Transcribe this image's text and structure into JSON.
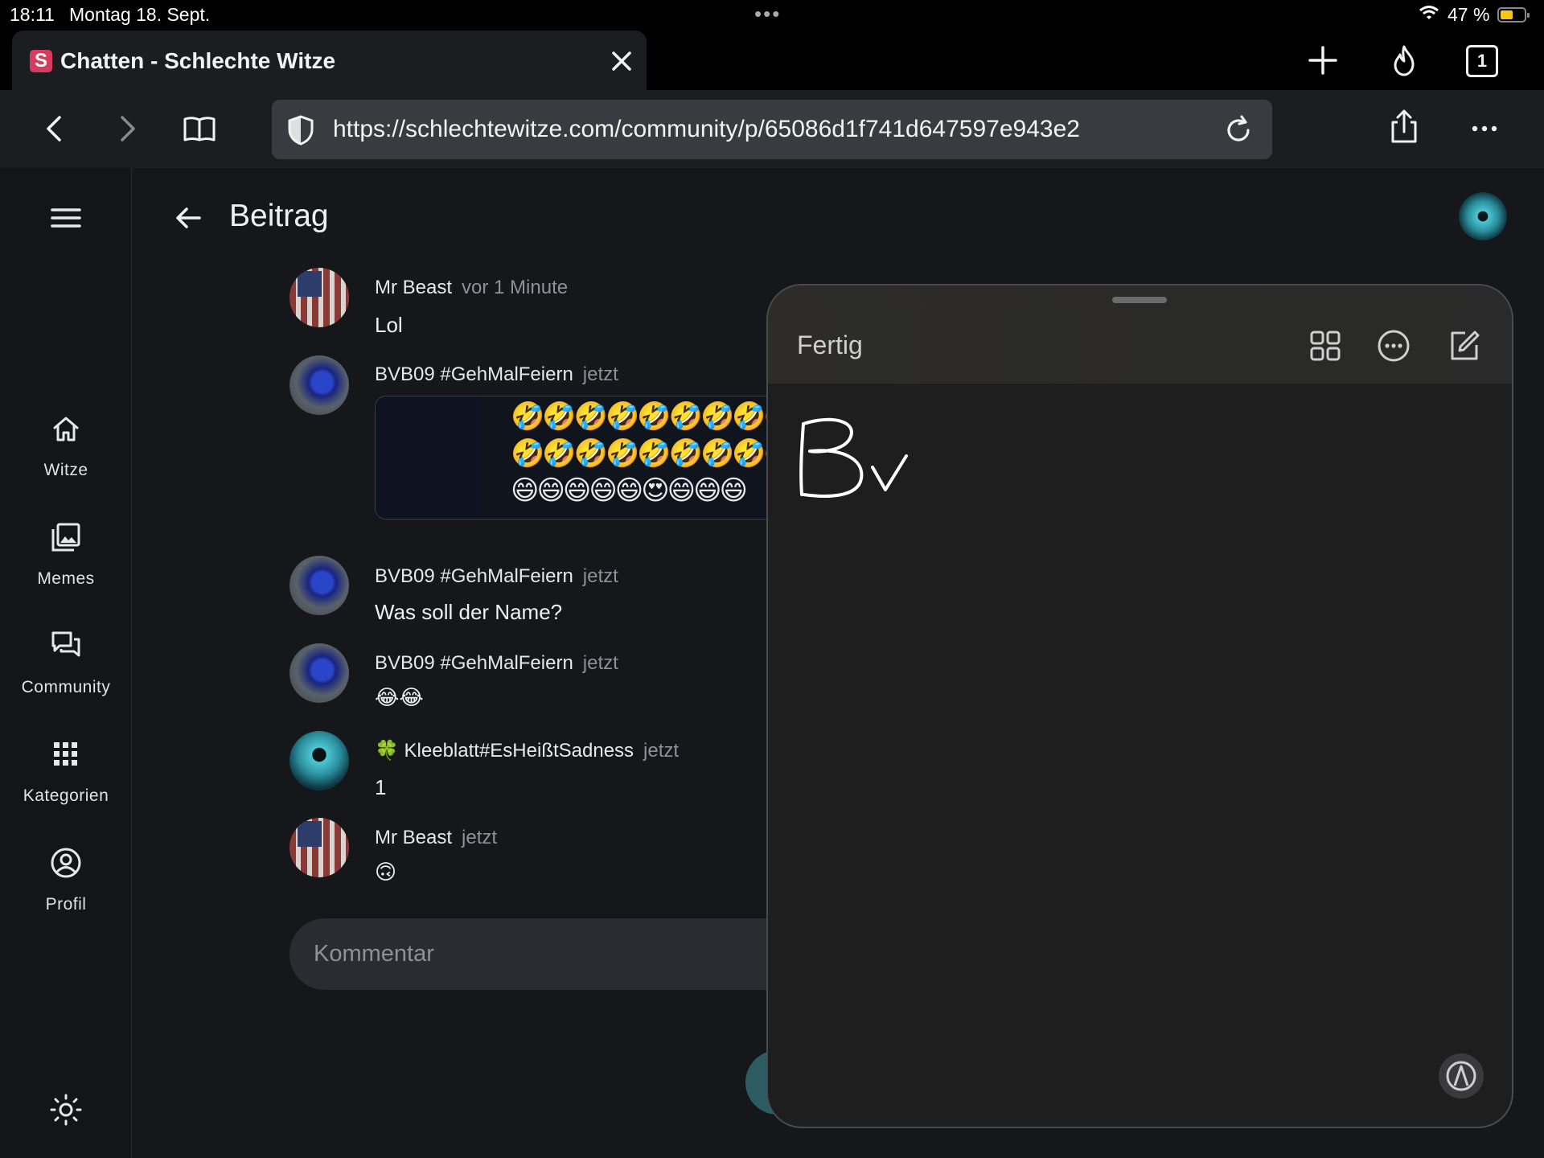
{
  "status_bar": {
    "time": "18:11",
    "date": "Montag 18. Sept.",
    "battery": "47 %"
  },
  "browser": {
    "tab_title": "Chatten - Schlechte Witze",
    "favicon_letter": "S",
    "tab_count": "1",
    "url": "https://schlechtewitze.com/community/p/65086d1f741d647597e943e2"
  },
  "sidebar": {
    "items": [
      {
        "label": "Witze",
        "icon": "home-icon"
      },
      {
        "label": "Memes",
        "icon": "gallery-icon"
      },
      {
        "label": "Community",
        "icon": "chat-icon"
      },
      {
        "label": "Kategorien",
        "icon": "grid-icon"
      },
      {
        "label": "Profil",
        "icon": "profile-icon"
      }
    ]
  },
  "header": {
    "title": "Beitrag"
  },
  "comments": [
    {
      "author": "Mr Beast",
      "time": "vor 1 Minute",
      "text": "Lol"
    },
    {
      "author": "BVB09 #GehMalFeiern",
      "time": "jetzt",
      "text": "🤣🤣🤣🤣🤣🤣🤣🤣🤣"
    },
    {
      "author": "BVB09 #GehMalFeiern",
      "time": "jetzt",
      "text": "Was soll der Name?"
    },
    {
      "author": "BVB09 #GehMalFeiern",
      "time": "jetzt",
      "text": "😂😂"
    },
    {
      "author": "🍀 Kleeblatt#EsHeißtSadness",
      "time": "jetzt",
      "text": "1"
    },
    {
      "author": "Mr Beast",
      "time": "jetzt",
      "text": "🙃"
    }
  ],
  "image_emojis": {
    "row1": "🤣🤣🤣🤣🤣🤣🤣🤣🤣",
    "row2": "🤣🤣🤣🤣🤣🤣🤣🤣🤣",
    "row3": "😄😄😄😄😄😍😄😄😄"
  },
  "comment_input": {
    "placeholder": "Kommentar"
  },
  "quick_note": {
    "done_label": "Fertig",
    "handwriting": "Bv"
  }
}
